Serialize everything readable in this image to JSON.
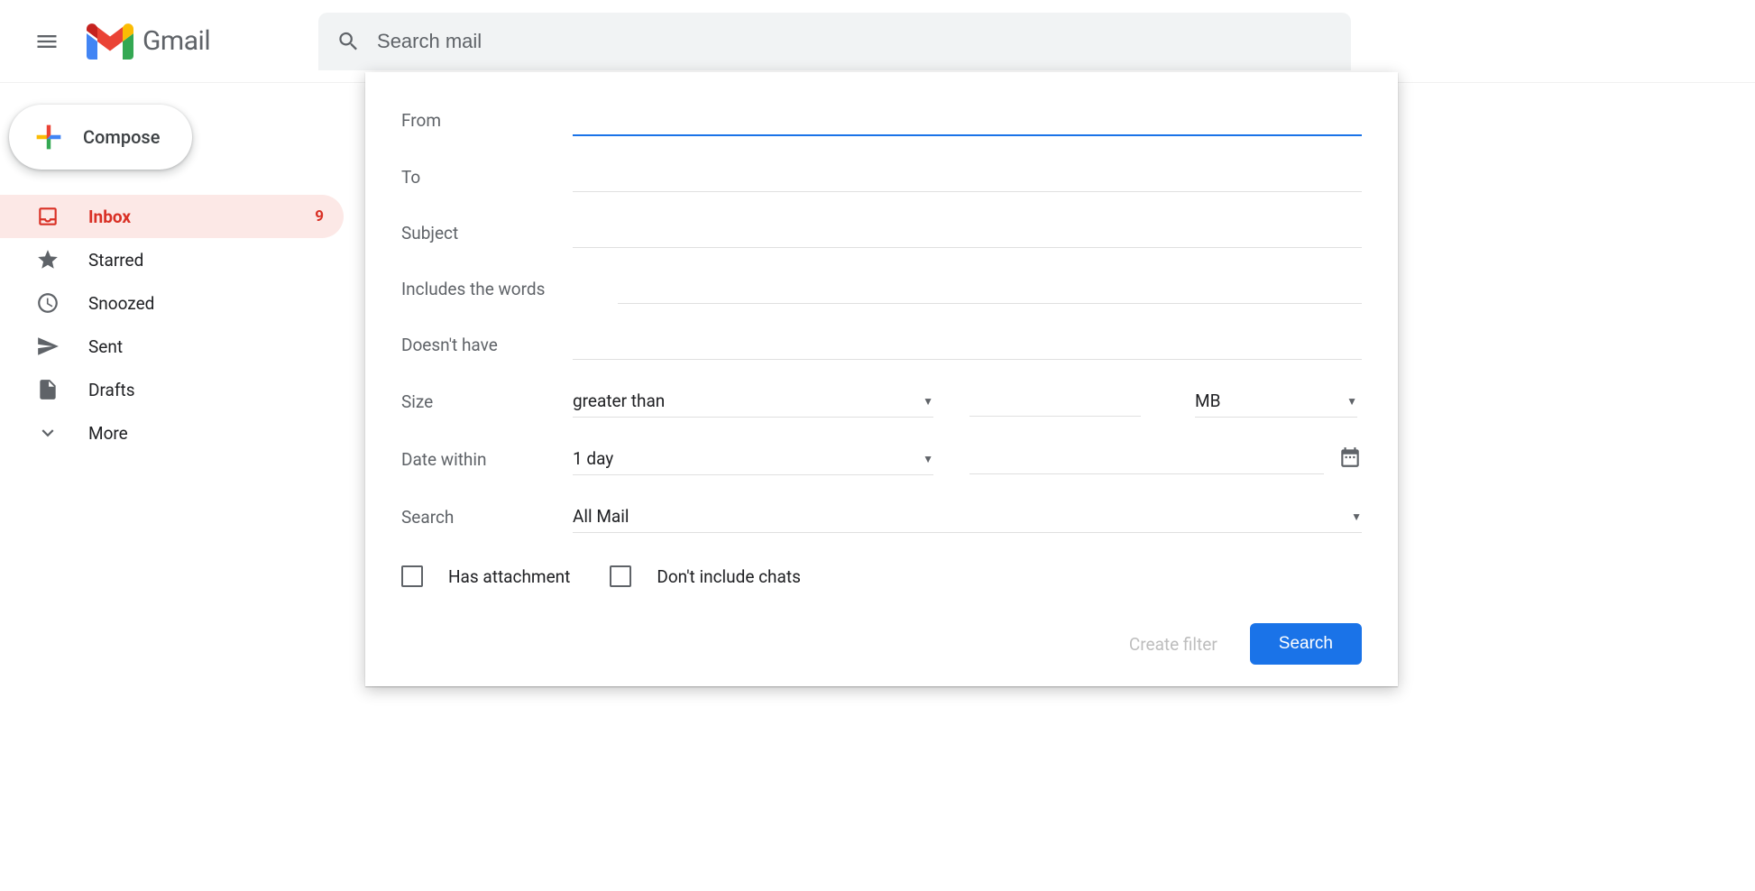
{
  "header": {
    "app_name": "Gmail",
    "search_placeholder": "Search mail"
  },
  "compose": {
    "label": "Compose"
  },
  "sidebar": {
    "items": [
      {
        "label": "Inbox",
        "count": "9",
        "active": true
      },
      {
        "label": "Starred"
      },
      {
        "label": "Snoozed"
      },
      {
        "label": "Sent"
      },
      {
        "label": "Drafts"
      },
      {
        "label": "More"
      }
    ]
  },
  "filter": {
    "from_label": "From",
    "to_label": "To",
    "subject_label": "Subject",
    "includes_label": "Includes the words",
    "doesnt_label": "Doesn't have",
    "size_label": "Size",
    "size_comparator": "greater than",
    "size_unit": "MB",
    "date_label": "Date within",
    "date_range": "1 day",
    "search_label": "Search",
    "search_folder": "All Mail",
    "has_attachment_label": "Has attachment",
    "dont_include_chats_label": "Don't include chats",
    "create_filter_label": "Create filter",
    "search_button_label": "Search"
  }
}
